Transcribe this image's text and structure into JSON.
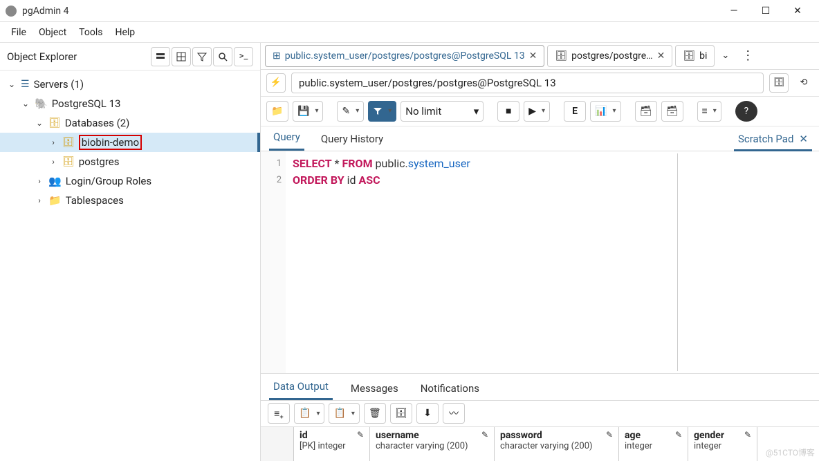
{
  "window": {
    "title": "pgAdmin 4"
  },
  "menu": {
    "file": "File",
    "object": "Object",
    "tools": "Tools",
    "help": "Help"
  },
  "sidebar": {
    "title": "Object Explorer",
    "tree": {
      "servers": "Servers (1)",
      "pg": "PostgreSQL 13",
      "databases": "Databases (2)",
      "db1": "biobin-demo",
      "db2": "postgres",
      "roles": "Login/Group Roles",
      "tablespaces": "Tablespaces"
    }
  },
  "tabs": {
    "t1": "public.system_user/postgres/postgres@PostgreSQL 13",
    "t2": "postgres/postgre…",
    "t3": "bi"
  },
  "path": "public.system_user/postgres/postgres@PostgreSQL 13",
  "toolbar": {
    "nolimit": "No limit"
  },
  "querytabs": {
    "query": "Query",
    "history": "Query History"
  },
  "scratch": "Scratch Pad",
  "sql": {
    "l1_kw1": "SELECT",
    "l1_star": " * ",
    "l1_kw2": "FROM",
    "l1_schema": " public.",
    "l1_table": "system_user",
    "l2_kw1": "ORDER",
    "l2_kw2": " BY",
    "l2_rest": " id ",
    "l2_kw3": "ASC"
  },
  "output": {
    "data": "Data Output",
    "messages": "Messages",
    "notifications": "Notifications"
  },
  "cols": {
    "c1n": "id",
    "c1t": "[PK] integer",
    "c2n": "username",
    "c2t": "character varying (200)",
    "c3n": "password",
    "c3t": "character varying (200)",
    "c4n": "age",
    "c4t": "integer",
    "c5n": "gender",
    "c5t": "integer"
  },
  "watermark": "@51CTO博客"
}
